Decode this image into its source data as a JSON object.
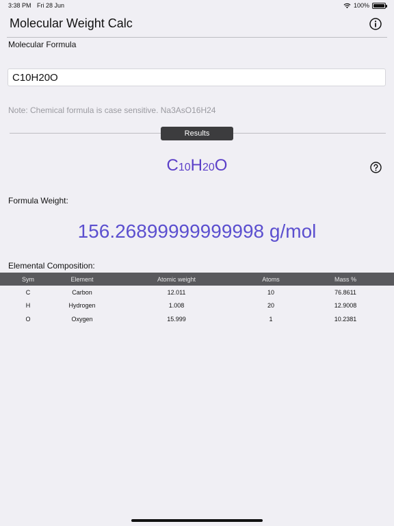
{
  "status": {
    "time": "3:38 PM",
    "date": "Fri 28 Jun",
    "battery_text": "100%",
    "battery_level": 1.0
  },
  "app": {
    "title": "Molecular Weight Calc",
    "info_icon": "info-circle-icon"
  },
  "input": {
    "label": "Molecular Formula",
    "value": "C10H20O",
    "note": "Note: Chemical formula is case sensitive. Na3AsO16H24"
  },
  "results": {
    "badge": "Results",
    "help_icon": "question-circle-icon",
    "formula_parts": [
      {
        "text": "C",
        "sub": false
      },
      {
        "text": "10",
        "sub": true
      },
      {
        "text": "H",
        "sub": false
      },
      {
        "text": "20",
        "sub": true
      },
      {
        "text": "O",
        "sub": false
      }
    ],
    "formula_weight_label": "Formula Weight:",
    "formula_weight": "156.26899999999998 g/mol",
    "composition_label": "Elemental Composition:"
  },
  "table": {
    "headers": [
      "Sym",
      "Element",
      "Atomic weight",
      "Atoms",
      "Mass %"
    ],
    "rows": [
      [
        "C",
        "Carbon",
        "12.011",
        "10",
        "76.8611"
      ],
      [
        "H",
        "Hydrogen",
        "1.008",
        "20",
        "12.9008"
      ],
      [
        "O",
        "Oxygen",
        "15.999",
        "1",
        "10.2381"
      ]
    ]
  },
  "colors": {
    "accent": "#5b3fc8",
    "weight": "#5b4fcf",
    "header_bg": "#59595d",
    "badge_bg": "#3c3c3e",
    "background": "#f0eff4"
  }
}
